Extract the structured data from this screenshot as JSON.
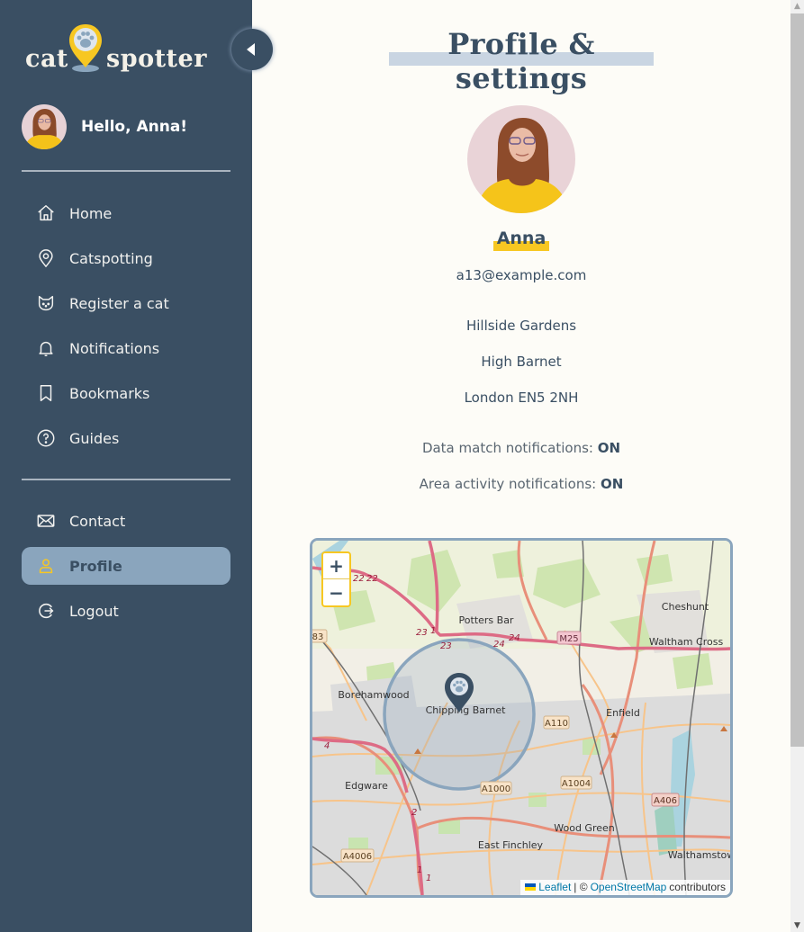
{
  "brand": {
    "word_left": "cat",
    "word_right": "spotter",
    "logo_icon": "paw-pin-icon",
    "colors": {
      "sidebar": "#3a4f63",
      "accent_yellow": "#f7c722",
      "active_item": "#8aa5bd",
      "page_bg": "#fdfcf7",
      "title_highlight": "#c9d5e2"
    }
  },
  "sidebar": {
    "greeting": "Hello, Anna!",
    "collapse_icon": "caret-left-icon",
    "primary_nav": [
      {
        "label": "Home",
        "icon": "home-icon"
      },
      {
        "label": "Catspotting",
        "icon": "map-pin-icon"
      },
      {
        "label": "Register a cat",
        "icon": "cat-face-icon"
      },
      {
        "label": "Notifications",
        "icon": "bell-icon"
      },
      {
        "label": "Bookmarks",
        "icon": "bookmark-icon"
      },
      {
        "label": "Guides",
        "icon": "question-circle-icon"
      }
    ],
    "secondary_nav": [
      {
        "label": "Contact",
        "icon": "envelope-icon",
        "active": false
      },
      {
        "label": "Profile",
        "icon": "user-icon",
        "active": true
      },
      {
        "label": "Logout",
        "icon": "logout-icon",
        "active": false
      }
    ]
  },
  "profile": {
    "page_title": "Profile & settings",
    "name": "Anna",
    "email": "a13@example.com",
    "address": [
      "Hillside Gardens",
      "High Barnet",
      "London EN5 2NH"
    ],
    "notifications": [
      {
        "label": "Data match notifications:",
        "value": "ON"
      },
      {
        "label": "Area activity notifications:",
        "value": "ON"
      }
    ]
  },
  "map": {
    "zoom_in": "+",
    "zoom_out": "−",
    "marker_icon": "paw-marker-icon",
    "places": [
      "Potters Bar",
      "Cheshunt",
      "Waltham Cross",
      "Borehamwood",
      "Chipping Barnet",
      "Enfield",
      "Edgware",
      "Wood Green",
      "East Finchley",
      "Walthamstow"
    ],
    "road_labels": [
      "M25",
      "A110",
      "A1000",
      "A1004",
      "A406",
      "A4006",
      "83"
    ],
    "junction_labels": [
      "22",
      "22",
      "23",
      "1",
      "23",
      "24",
      "24",
      "4",
      "2",
      "1",
      "1"
    ],
    "attribution": {
      "leaflet": "Leaflet",
      "separator": "| ©",
      "osm": "OpenStreetMap",
      "suffix": "contributors"
    }
  },
  "scrollbar": {
    "up": "▲",
    "down": "▼"
  }
}
